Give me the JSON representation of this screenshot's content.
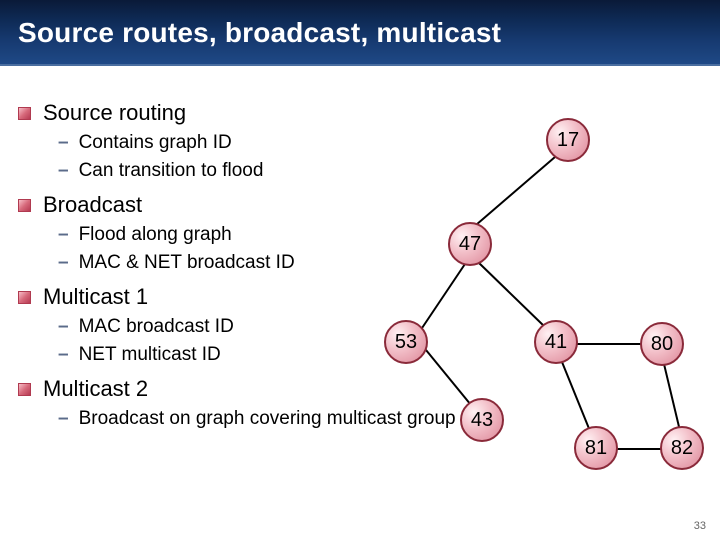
{
  "title": "Source routes, broadcast, multicast",
  "bullets": [
    {
      "label": "Source routing",
      "subs": [
        "Contains graph ID",
        "Can transition to flood"
      ]
    },
    {
      "label": "Broadcast",
      "subs": [
        "Flood along graph",
        "MAC & NET broadcast ID"
      ]
    },
    {
      "label": "Multicast 1",
      "subs": [
        "MAC broadcast ID",
        "NET multicast ID"
      ]
    },
    {
      "label": "Multicast 2",
      "subs": [
        "Broadcast on graph covering multicast group"
      ]
    }
  ],
  "nodes": {
    "n17": "17",
    "n47": "47",
    "n53": "53",
    "n41": "41",
    "n80": "80",
    "n43": "43",
    "n81": "81",
    "n82": "82"
  },
  "page_number": "33"
}
